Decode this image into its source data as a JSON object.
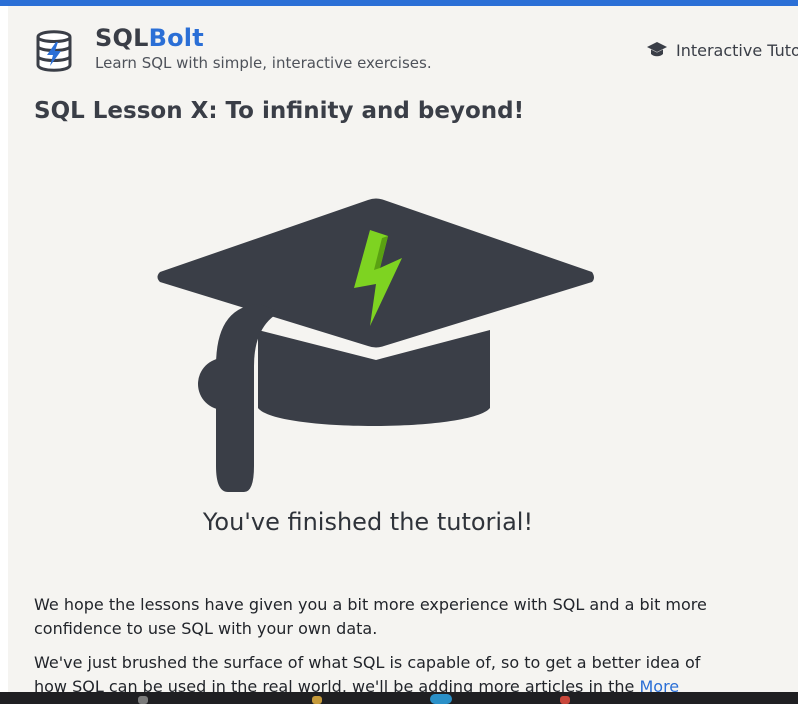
{
  "brand": {
    "name_part1": "SQL",
    "name_part2": "Bolt",
    "tagline": "Learn SQL with simple, interactive exercises."
  },
  "nav": {
    "tutorial_label": "Interactive Tuto"
  },
  "lesson": {
    "title": "SQL Lesson X: To infinity and beyond!"
  },
  "completion": {
    "message": "You've finished the tutorial!"
  },
  "body": {
    "para1": "We hope the lessons have given you a bit more experience with SQL and a bit more confidence to use SQL with your own data.",
    "para2": "We've just brushed the surface of what SQL is capable of, so to get a better idea of how SQL can be used in the real world, we'll be adding more articles in the",
    "para2_link": "More"
  },
  "colors": {
    "accent": "#2b6fd6",
    "bolt_green": "#7ed321",
    "cap_dark": "#3a3e47",
    "page_bg": "#f5f4f1"
  },
  "icons": {
    "logo": "database-bolt-icon",
    "tutorial": "graduation-cap-icon",
    "hero": "graduation-cap-bolt-illustration"
  }
}
